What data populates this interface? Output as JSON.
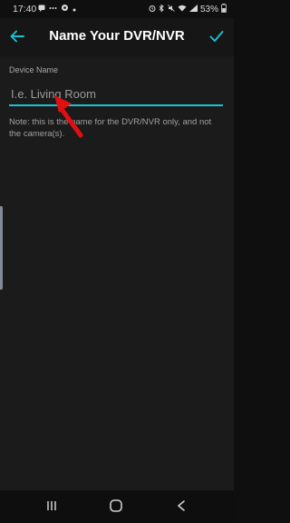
{
  "status_bar": {
    "time": "17:40",
    "battery": "53%"
  },
  "header": {
    "title": "Name Your DVR/NVR"
  },
  "form": {
    "label": "Device Name",
    "placeholder": "I.e. Living Room",
    "value": "",
    "note": "Note: this is the name for the DVR/NVR only, and not the camera(s)."
  },
  "icons": {
    "back": "arrow-left-icon",
    "confirm": "check-icon",
    "recent": "recent-apps-icon",
    "home": "home-icon",
    "nav_back": "chevron-left-icon"
  },
  "colors": {
    "accent": "#18c3d6",
    "annotation_arrow": "#e10f0f",
    "background": "#1b1b1b"
  }
}
